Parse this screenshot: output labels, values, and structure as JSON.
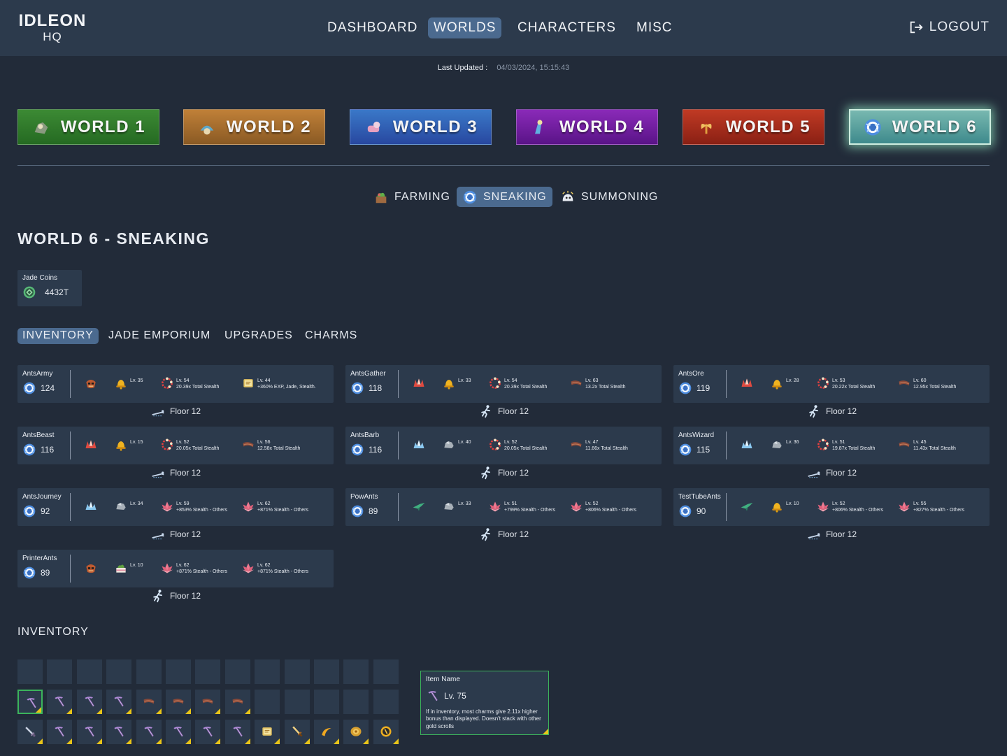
{
  "header": {
    "logo_line1": "IDLEON",
    "logo_line2": "HQ",
    "nav": [
      "DASHBOARD",
      "WORLDS",
      "CHARACTERS",
      "MISC"
    ],
    "active_nav": "WORLDS",
    "logout_label": "LOGOUT"
  },
  "last_updated": {
    "label": "Last Updated :",
    "value": "04/03/2024, 15:15:43"
  },
  "worlds": [
    {
      "label": "WORLD 1",
      "color": "#2f7a2a"
    },
    {
      "label": "WORLD 2",
      "color": "#a86a2c"
    },
    {
      "label": "WORLD 3",
      "color": "#2a5aa8"
    },
    {
      "label": "WORLD 4",
      "color": "#6a1a9a"
    },
    {
      "label": "WORLD 5",
      "color": "#a82a1c"
    },
    {
      "label": "WORLD 6",
      "color": "#5aa8a8"
    }
  ],
  "subtabs": [
    "FARMING",
    "SNEAKING",
    "SUMMONING"
  ],
  "page_title": "WORLD 6 - SNEAKING",
  "jade_coins": {
    "label": "Jade Coins",
    "value": "4432T"
  },
  "tabs": [
    "INVENTORY",
    "JADE EMPORIUM",
    "UPGRADES",
    "CHARMS"
  ],
  "ninjas": [
    {
      "name": "AntsArmy",
      "level": "124",
      "floor": "Floor 12",
      "slots": [
        {
          "icon": "mask-icon",
          "lv": "",
          "desc": ""
        },
        {
          "icon": "bell-icon",
          "lv": "Lv. 35",
          "desc": ""
        },
        {
          "icon": "beads-icon",
          "lv": "Lv. 54",
          "desc": "20.39x Total Stealth"
        },
        {
          "icon": "scroll-icon",
          "lv": "Lv. 44",
          "desc": "+360% EXP, Jade, Stealth."
        }
      ]
    },
    {
      "name": "AntsGather",
      "level": "118",
      "floor": "Floor 12",
      "slots": [
        {
          "icon": "crystal-red-icon",
          "lv": "",
          "desc": ""
        },
        {
          "icon": "bell-icon",
          "lv": "Lv. 33",
          "desc": ""
        },
        {
          "icon": "beads-icon",
          "lv": "Lv. 54",
          "desc": "20.39x Total Stealth"
        },
        {
          "icon": "belt-icon",
          "lv": "Lv. 63",
          "desc": "13.2x Total Stealth"
        }
      ]
    },
    {
      "name": "AntsOre",
      "level": "119",
      "floor": "Floor 12",
      "slots": [
        {
          "icon": "crystal-red-icon",
          "lv": "",
          "desc": ""
        },
        {
          "icon": "bell-icon",
          "lv": "Lv. 28",
          "desc": ""
        },
        {
          "icon": "beads-icon",
          "lv": "Lv. 53",
          "desc": "20.22x Total Stealth"
        },
        {
          "icon": "belt-icon",
          "lv": "Lv. 60",
          "desc": "12.95x Total Stealth"
        }
      ]
    },
    {
      "name": "AntsBeast",
      "level": "116",
      "floor": "Floor 12",
      "slots": [
        {
          "icon": "crystal-red-icon",
          "lv": "",
          "desc": ""
        },
        {
          "icon": "bell-icon",
          "lv": "Lv. 15",
          "desc": ""
        },
        {
          "icon": "beads-icon",
          "lv": "Lv. 52",
          "desc": "20.05x Total Stealth"
        },
        {
          "icon": "belt-icon",
          "lv": "Lv. 56",
          "desc": "12.58x Total Stealth"
        }
      ]
    },
    {
      "name": "AntsBarb",
      "level": "116",
      "floor": "Floor 12",
      "slots": [
        {
          "icon": "crystal-blue-icon",
          "lv": "",
          "desc": ""
        },
        {
          "icon": "rock-icon",
          "lv": "Lv. 40",
          "desc": ""
        },
        {
          "icon": "beads-icon",
          "lv": "Lv. 52",
          "desc": "20.05x Total Stealth"
        },
        {
          "icon": "belt-icon",
          "lv": "Lv. 47",
          "desc": "11.66x Total Stealth"
        }
      ]
    },
    {
      "name": "AntsWizard",
      "level": "115",
      "floor": "Floor 12",
      "slots": [
        {
          "icon": "crystal-blue-icon",
          "lv": "",
          "desc": ""
        },
        {
          "icon": "rock-icon",
          "lv": "Lv. 36",
          "desc": ""
        },
        {
          "icon": "beads-icon",
          "lv": "Lv. 51",
          "desc": "19.87x Total Stealth"
        },
        {
          "icon": "belt-icon",
          "lv": "Lv. 45",
          "desc": "11.43x Total Stealth"
        }
      ]
    },
    {
      "name": "AntsJourney",
      "level": "92",
      "floor": "Floor 12",
      "slots": [
        {
          "icon": "crystal-blue-icon",
          "lv": "",
          "desc": ""
        },
        {
          "icon": "rock-icon",
          "lv": "Lv. 34",
          "desc": ""
        },
        {
          "icon": "lotus-icon",
          "lv": "Lv. 59",
          "desc": "+853% Stealth - Others"
        },
        {
          "icon": "lotus-icon",
          "lv": "Lv. 62",
          "desc": "+871% Stealth - Others"
        }
      ]
    },
    {
      "name": "PowAnts",
      "level": "89",
      "floor": "Floor 12",
      "slots": [
        {
          "icon": "shuriken-icon",
          "lv": "",
          "desc": ""
        },
        {
          "icon": "rock-icon",
          "lv": "Lv. 33",
          "desc": ""
        },
        {
          "icon": "lotus-icon",
          "lv": "Lv. 51",
          "desc": "+799% Stealth - Others"
        },
        {
          "icon": "lotus-icon",
          "lv": "Lv. 52",
          "desc": "+806% Stealth - Others"
        }
      ]
    },
    {
      "name": "TestTubeAnts",
      "level": "90",
      "floor": "Floor 12",
      "slots": [
        {
          "icon": "shuriken-icon",
          "lv": "",
          "desc": ""
        },
        {
          "icon": "bell-icon",
          "lv": "Lv. 10",
          "desc": ""
        },
        {
          "icon": "lotus-icon",
          "lv": "Lv. 52",
          "desc": "+806% Stealth - Others"
        },
        {
          "icon": "lotus-icon",
          "lv": "Lv. 55",
          "desc": "+827% Stealth - Others"
        }
      ]
    },
    {
      "name": "PrinterAnts",
      "level": "89",
      "floor": "Floor 12",
      "slots": [
        {
          "icon": "mask-icon",
          "lv": "",
          "desc": ""
        },
        {
          "icon": "cake-icon",
          "lv": "Lv. 10",
          "desc": ""
        },
        {
          "icon": "lotus-icon",
          "lv": "Lv. 62",
          "desc": "+871% Stealth - Others"
        },
        {
          "icon": "lotus-icon",
          "lv": "Lv. 62",
          "desc": "+871% Stealth - Others"
        }
      ]
    }
  ],
  "inventory": {
    "title": "INVENTORY",
    "rows": [
      [
        "",
        "",
        "",
        "",
        "",
        "",
        "",
        "",
        "",
        "",
        "",
        "",
        ""
      ],
      [
        "pickaxe-icon",
        "pickaxe-icon",
        "pickaxe-icon",
        "pickaxe-icon",
        "belt-icon",
        "belt-icon",
        "belt-icon",
        "belt-icon",
        "",
        "",
        "",
        "",
        ""
      ],
      [
        "sword-icon",
        "pickaxe-icon",
        "pickaxe-icon",
        "pickaxe-icon",
        "pickaxe-icon",
        "pickaxe-icon",
        "pickaxe-icon",
        "pickaxe-icon",
        "scroll-icon",
        "dagger-icon",
        "boomerang-icon",
        "disc-icon",
        "coin-icon"
      ]
    ],
    "selected": "1-0"
  },
  "tooltip": {
    "name": "Item Name",
    "level": "Lv. 75",
    "description": "If in inventory, most charms give 2.11x higher bonus than displayed. Doesn't stack with other gold scrolls"
  }
}
